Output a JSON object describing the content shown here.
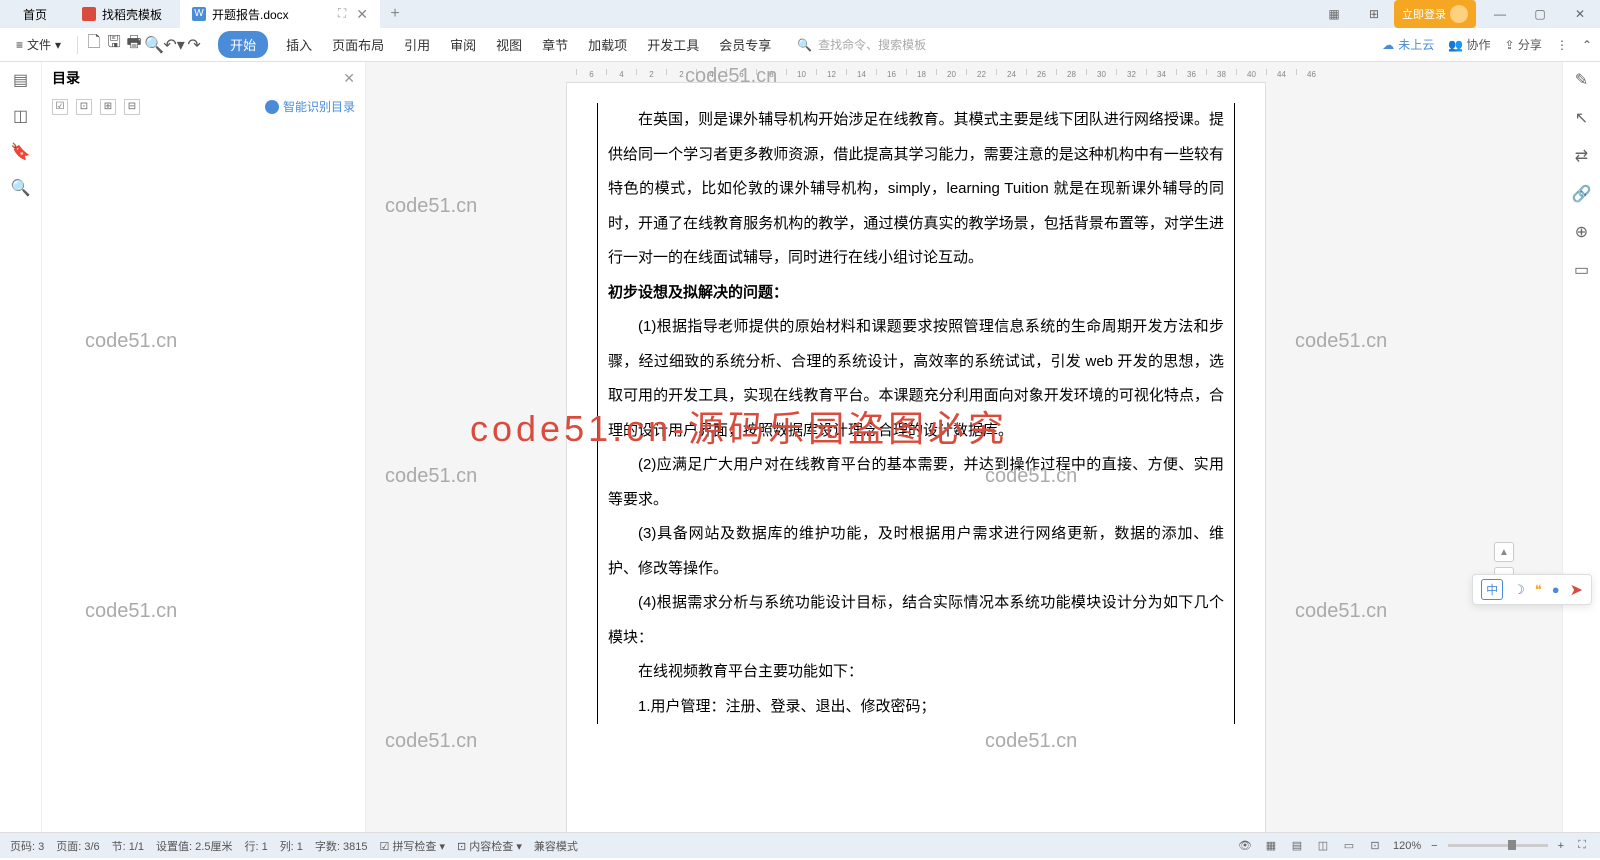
{
  "tabs": {
    "home": "首页",
    "dk": "找稻壳模板",
    "active": "开题报告.docx"
  },
  "login": "立即登录",
  "toolbar": {
    "menu": "文件"
  },
  "ribbon": [
    "开始",
    "插入",
    "页面布局",
    "引用",
    "审阅",
    "视图",
    "章节",
    "加载项",
    "开发工具",
    "会员专享"
  ],
  "search": {
    "placeholder": "查找命令、搜索模板"
  },
  "cloud": {
    "label": "未上云",
    "collab": "协作",
    "share": "分享"
  },
  "toc": {
    "title": "目录",
    "smart": "智能识别目录"
  },
  "ruler": [
    "6",
    "4",
    "2",
    "2",
    "4",
    "6",
    "8",
    "10",
    "12",
    "14",
    "16",
    "18",
    "20",
    "22",
    "24",
    "26",
    "28",
    "30",
    "32",
    "34",
    "36",
    "38",
    "40",
    "44",
    "46"
  ],
  "doc": {
    "p1": "在英国，则是课外辅导机构开始涉足在线教育。其模式主要是线下团队进行网络授课。提供给同一个学习者更多教师资源，借此提高其学习能力，需要注意的是这种机构中有一些较有特色的模式，比如伦敦的课外辅导机构，simply，learning Tuition 就是在现新课外辅导的同时，开通了在线教育服务机构的教学，通过模仿真实的教学场景，包括背景布置等，对学生进行一对一的在线面试辅导，同时进行在线小组讨论互动。",
    "h1": "初步设想及拟解决的问题：",
    "p2": "(1)根据指导老师提供的原始材料和课题要求按照管理信息系统的生命周期开发方法和步骤，经过细致的系统分析、合理的系统设计，高效率的系统试试，引发 web 开发的思想，选取可用的开发工具，实现在线教育平台。本课题充分利用面向对象开发环境的可视化特点，合理的设计用户界面，按照数据库设计理念合理的设计数据库。",
    "p3": "(2)应满足广大用户对在线教育平台的基本需要，并达到操作过程中的直接、方便、实用等要求。",
    "p4": "(3)具备网站及数据库的维护功能，及时根据用户需求进行网络更新，数据的添加、维护、修改等操作。",
    "p5": "(4)根据需求分析与系统功能设计目标，结合实际情况本系统功能模块设计分为如下几个模块：",
    "p6": "在线视频教育平台主要功能如下：",
    "p7": "1.用户管理：注册、登录、退出、修改密码；"
  },
  "watermarks": {
    "small": "code51.cn",
    "big": "code51.cn-源码乐园盗图必究"
  },
  "status": {
    "page_num": "页码: 3",
    "page_of": "页面: 3/6",
    "section": "节: 1/1",
    "set": "设置值: 2.5厘米",
    "row": "行: 1",
    "col": "列: 1",
    "words": "字数: 3815",
    "spell": "拼写检查",
    "content": "内容检查",
    "compat": "兼容模式",
    "zoom": "120%"
  },
  "ime": {
    "zh": "中"
  }
}
